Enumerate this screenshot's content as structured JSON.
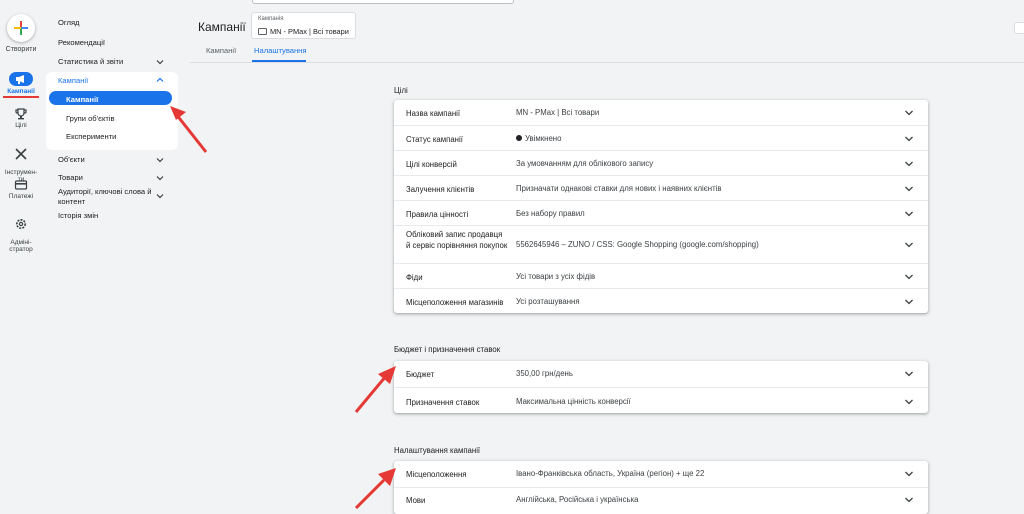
{
  "rail": {
    "create_label": "Створити",
    "items": [
      {
        "label": "Кампанії",
        "icon": "megaphone-icon"
      },
      {
        "label": "Цілі",
        "icon": "trophy-icon"
      },
      {
        "label": "Інструмен-\nти",
        "icon": "tools-icon"
      },
      {
        "label": "Платежі",
        "icon": "credit-card-icon"
      },
      {
        "label": "Адміні-\nстратор",
        "icon": "gear-icon"
      }
    ]
  },
  "nav": {
    "overview": "Огляд",
    "recommendations": "Рекомендації",
    "stats": "Статистика й звіти",
    "campaigns": "Кампанії",
    "sub": [
      "Кампанії",
      "Групи об'єктів",
      "Експерименти"
    ],
    "objects": "Об'єкти",
    "products": "Товари",
    "audiences": "Аудиторії, ключові слова й контент",
    "history": "Історія змін"
  },
  "header": {
    "title": "Кампанії",
    "chip_caption": "Кампанія",
    "chip_value": "MN - PMax | Всі товари",
    "tabs": [
      "Кампанії",
      "Налаштування"
    ]
  },
  "sections": [
    {
      "title": "Цілі",
      "rows": [
        {
          "label": "Назва кампанії",
          "value": "MN - PMax | Всі товари"
        },
        {
          "label": "Статус кампанії",
          "value": "Увімкнено"
        },
        {
          "label": "Цілі конверсій",
          "value": "За умовчанням для облікового запису"
        },
        {
          "label": "Залучення клієнтів",
          "value": "Призначати однакові ставки для нових і наявних клієнтів"
        },
        {
          "label": "Правила цінності",
          "value": "Без набору правил"
        },
        {
          "label": "Обліковий запис продавця й сервіс порівняння покупок",
          "value": "5562645946 – ZUNO / CSS: Google Shopping (google.com/shopping)"
        },
        {
          "label": "Фіди",
          "value": "Усі товари з усіх фідів"
        },
        {
          "label": "Місцеположення магазинів",
          "value": "Усі розташування"
        }
      ]
    },
    {
      "title": "Бюджет і призначення ставок",
      "rows": [
        {
          "label": "Бюджет",
          "value": "350,00 грн/день"
        },
        {
          "label": "Призначення ставок",
          "value": "Максимальна цінність конверсії"
        }
      ]
    },
    {
      "title": "Налаштування кампанії",
      "rows": [
        {
          "label": "Місцеположення",
          "value": "Івано-Франківська область, Україна (регіон) + ще 22"
        },
        {
          "label": "Мови",
          "value": "Англійська, Російська і українська"
        }
      ]
    }
  ],
  "colors": {
    "accent": "#1a73e8",
    "annotation": "#e53935"
  }
}
